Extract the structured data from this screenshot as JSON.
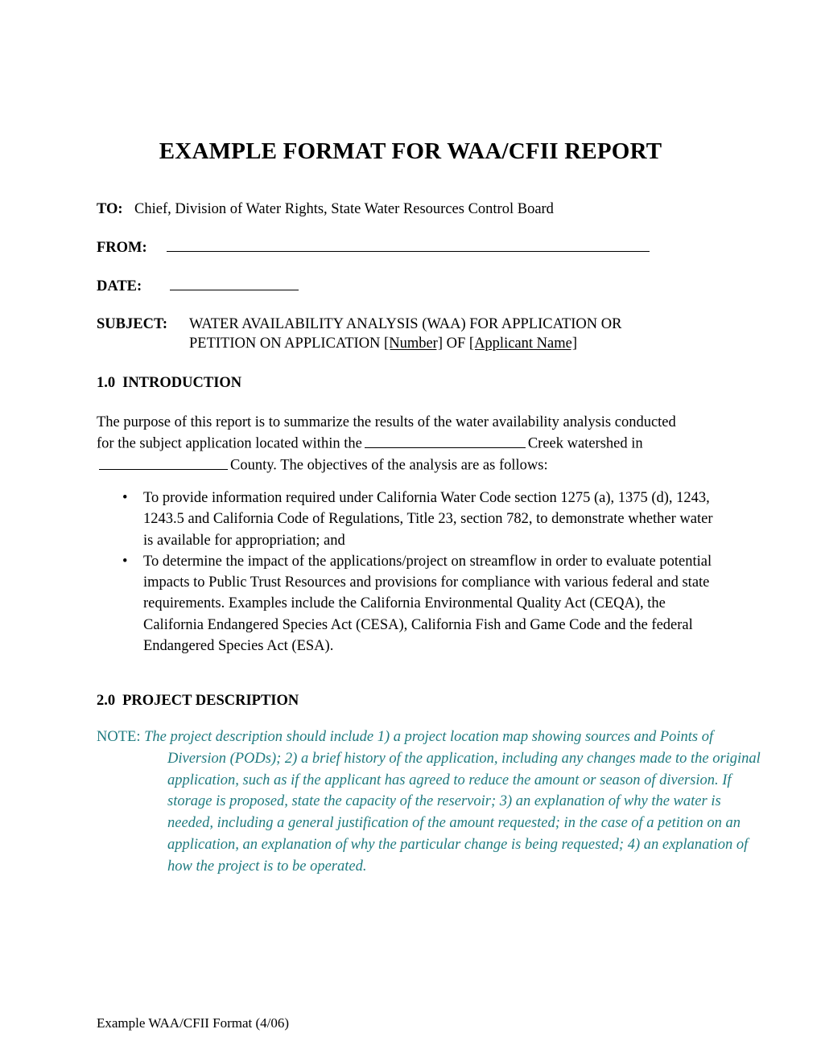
{
  "document": {
    "title": "EXAMPLE FORMAT FOR WAA/CFII REPORT",
    "footer": "Example WAA/CFII Format (4/06)"
  },
  "memo": {
    "to_label": "TO:",
    "to_value": "Chief, Division of Water Rights, State Water Resources Control Board",
    "from_label": "FROM:",
    "from_value": "",
    "date_label": "DATE:",
    "date_value": "",
    "subject_label": "SUBJECT:",
    "subject_line1": "WATER AVAILABILITY ANALYSIS (WAA) FOR APPLICATION OR",
    "subject_line2_pre": "PETITION ON APPLICATION ",
    "subject_number_placeholder": "[Number]",
    "subject_line2_mid": " OF ",
    "subject_applicant_placeholder": "[Applicant Name]"
  },
  "sections": {
    "intro": {
      "number": "1.0",
      "heading": "INTRODUCTION",
      "para_part1": "The purpose of this report is to summarize the results of the water availability analysis conducted for the subject application located within the",
      "para_part2": "Creek watershed in",
      "para_part3": "County.  The objectives of the analysis are as follows:",
      "bullets": [
        "To provide information required under California Water Code section 1275 (a), 1375 (d), 1243, 1243.5 and California Code of Regulations, Title 23, section 782, to demonstrate whether water is available for appropriation; and",
        "To determine the impact of the applications/project on streamflow in order to evaluate potential impacts to Public Trust Resources and provisions for compliance with various federal and state requirements.  Examples include the California Environmental Quality Act (CEQA), the California Endangered Species Act (CESA), California Fish and Game Code and the federal Endangered Species Act (ESA)."
      ],
      "bullet_glyph": "•"
    },
    "project_description": {
      "number": "2.0",
      "heading": "PROJECT DESCRIPTION",
      "note_label": "NOTE:",
      "note_text": "The project description should include 1) a project location map showing sources and Points of Diversion (PODs); 2) a brief history of the application, including any changes made to the original application, such as if the applicant has agreed to reduce the amount or season of diversion. If storage is proposed, state the capacity of the reservoir; 3) an explanation of why the water is needed, including a general justification of the amount requested; in the case of a petition on an application, an explanation of why the particular change is being requested; 4) an explanation of how the project is to be operated."
    }
  },
  "colors": {
    "note_teal": "#1E7A7F",
    "body_text": "#000000",
    "page_background": "#FFFFFF"
  }
}
